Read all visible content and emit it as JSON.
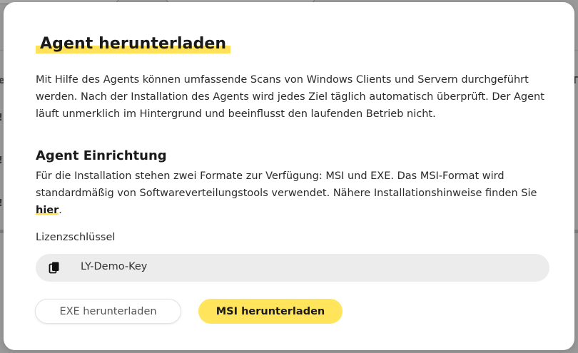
{
  "modal": {
    "title": "Agent herunterladen",
    "intro": "Mit Hilfe des Agents können umfassende Scans von Windows Clients und Servern durchgeführt werden. Nach der Installation des Agents wird jedes Ziel täglich automatisch überprüft. Der Agent läuft unmerklich im Hintergrund und beeinflusst den laufenden Betrieb nicht.",
    "setup_heading": "Agent Einrichtung",
    "setup_text": "Für die Installation stehen zwei Formate zur Verfügung: MSI und EXE. Das MSI-Format wird standardmäßig von Softwareverteilungstools verwendet. Nähere Installationshinweise finden Sie",
    "setup_link": "hier",
    "setup_text_end": ".",
    "license_label": "Lizenzschlüssel",
    "license_value": "LY-Demo-Key",
    "copy_icon": "copy-icon",
    "exe_button": "EXE herunterladen",
    "msi_button": "MSI herunterladen"
  },
  "colors": {
    "accent": "#ffe45c",
    "field_bg": "#ececec",
    "overlay": "#9a9a9a"
  }
}
